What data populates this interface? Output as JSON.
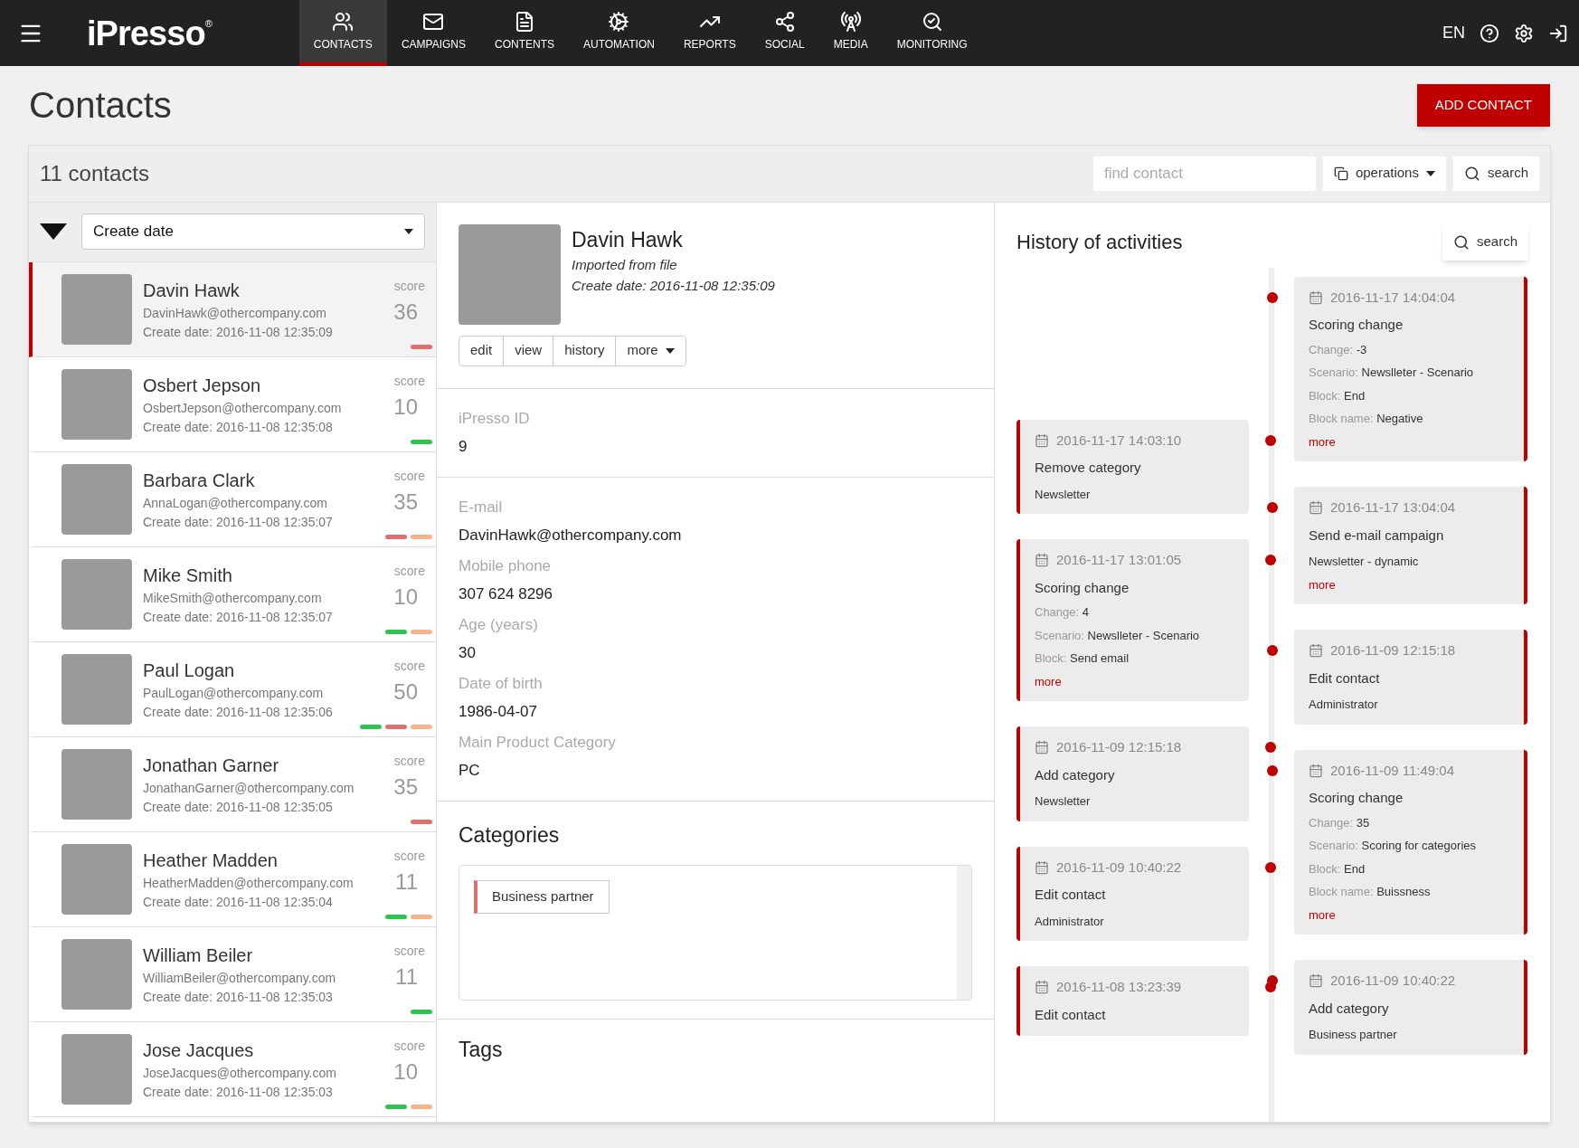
{
  "nav": {
    "logo": "iPresso",
    "logo_mark": "®",
    "items": [
      {
        "label": "CONTACTS",
        "selected": true
      },
      {
        "label": "CAMPAIGNS",
        "selected": false
      },
      {
        "label": "CONTENTS",
        "selected": false
      },
      {
        "label": "AUTOMATION",
        "selected": false
      },
      {
        "label": "REPORTS",
        "selected": false
      },
      {
        "label": "SOCIAL",
        "selected": false
      },
      {
        "label": "MEDIA",
        "selected": false
      },
      {
        "label": "MONITORING",
        "selected": false
      }
    ],
    "language": "EN"
  },
  "page": {
    "title": "Contacts",
    "add_button": "ADD CONTACT"
  },
  "panel": {
    "count": "11 contacts",
    "find_placeholder": "find contact",
    "operations": "operations",
    "search": "search"
  },
  "sort": {
    "value": "Create date"
  },
  "contacts": [
    {
      "name": "Davin Hawk",
      "email": "DavinHawk@othercompany.com",
      "created": "Create date: 2016-11-08 12:35:09",
      "score_label": "score",
      "score": "36",
      "selected": true,
      "bars": [
        {
          "color": "#e07070"
        }
      ]
    },
    {
      "name": "Osbert Jepson",
      "email": "OsbertJepson@othercompany.com",
      "created": "Create date: 2016-11-08 12:35:08",
      "score_label": "score",
      "score": "10",
      "selected": false,
      "bars": [
        {
          "color": "#2ec44f"
        }
      ]
    },
    {
      "name": "Barbara Clark",
      "email": "AnnaLogan@othercompany.com",
      "created": "Create date: 2016-11-08 12:35:07",
      "score_label": "score",
      "score": "35",
      "selected": false,
      "bars": [
        {
          "color": "#e07070"
        },
        {
          "color": "#f7b48a"
        }
      ]
    },
    {
      "name": "Mike Smith",
      "email": "MikeSmith@othercompany.com",
      "created": "Create date: 2016-11-08 12:35:07",
      "score_label": "score",
      "score": "10",
      "selected": false,
      "bars": [
        {
          "color": "#2ec44f"
        },
        {
          "color": "#f7b48a"
        }
      ]
    },
    {
      "name": "Paul Logan",
      "email": "PaulLogan@othercompany.com",
      "created": "Create date: 2016-11-08 12:35:06",
      "score_label": "score",
      "score": "50",
      "selected": false,
      "bars": [
        {
          "color": "#2ec44f"
        },
        {
          "color": "#e07070"
        },
        {
          "color": "#f7b48a"
        }
      ]
    },
    {
      "name": "Jonathan Garner",
      "email": "JonathanGarner@othercompany.com",
      "created": "Create date: 2016-11-08 12:35:05",
      "score_label": "score",
      "score": "35",
      "selected": false,
      "bars": [
        {
          "color": "#e07070"
        }
      ]
    },
    {
      "name": "Heather Madden",
      "email": "HeatherMadden@othercompany.com",
      "created": "Create date: 2016-11-08 12:35:04",
      "score_label": "score",
      "score": "11",
      "selected": false,
      "bars": [
        {
          "color": "#2ec44f"
        },
        {
          "color": "#f7b48a"
        }
      ]
    },
    {
      "name": "William Beiler",
      "email": "WilliamBeiler@othercompany.com",
      "created": "Create date: 2016-11-08 12:35:03",
      "score_label": "score",
      "score": "11",
      "selected": false,
      "bars": [
        {
          "color": "#2ec44f"
        }
      ]
    },
    {
      "name": "Jose Jacques",
      "email": "JoseJacques@othercompany.com",
      "created": "Create date: 2016-11-08 12:35:03",
      "score_label": "score",
      "score": "10",
      "selected": false,
      "bars": [
        {
          "color": "#2ec44f"
        },
        {
          "color": "#f7b48a"
        }
      ]
    }
  ],
  "detail": {
    "name": "Davin Hawk",
    "source": "Imported from file",
    "created": "Create date: 2016-11-08 12:35:09",
    "actions": [
      {
        "label": "edit",
        "kind": "plain"
      },
      {
        "label": "view",
        "kind": "plain"
      },
      {
        "label": "history",
        "kind": "plain"
      },
      {
        "label": "more",
        "kind": "dropdown"
      }
    ],
    "sections": [
      [
        {
          "label": "iPresso ID",
          "value": "9"
        }
      ],
      [
        {
          "label": "E-mail",
          "value": "DavinHawk@othercompany.com"
        },
        {
          "label": "Mobile phone",
          "value": "307 624 8296"
        },
        {
          "label": "Age (years)",
          "value": "30"
        },
        {
          "label": "Date of birth",
          "value": "1986-04-07"
        },
        {
          "label": "Main Product Category",
          "value": "PC"
        }
      ]
    ],
    "categories_title": "Categories",
    "categories": [
      "Business partner"
    ],
    "tags_title": "Tags"
  },
  "history": {
    "title": "History of activities",
    "search": "search",
    "left_column": [
      {
        "date": "2016-11-17 14:03:10",
        "title": "Remove category",
        "note": "Newsletter"
      },
      {
        "date": "2016-11-17 13:01:05",
        "title": "Scoring change",
        "details": [
          {
            "label": "Change:",
            "value": "4"
          },
          {
            "label": "Scenario:",
            "value": "Newslleter - Scenario"
          },
          {
            "label": "Block:",
            "value": "Send email"
          }
        ],
        "more": "more"
      },
      {
        "date": "2016-11-09 12:15:18",
        "title": "Add category",
        "note": "Newsletter"
      },
      {
        "date": "2016-11-09 10:40:22",
        "title": "Edit contact",
        "note": "Administrator"
      },
      {
        "date": "2016-11-08 13:23:39",
        "title": "Edit contact"
      }
    ],
    "right_column": [
      {
        "date": "2016-11-17 14:04:04",
        "title": "Scoring change",
        "details": [
          {
            "label": "Change:",
            "value": "-3"
          },
          {
            "label": "Scenario:",
            "value": "Newslleter - Scenario"
          },
          {
            "label": "Block:",
            "value": "End"
          },
          {
            "label": "Block name:",
            "value": "Negative"
          }
        ],
        "more": "more"
      },
      {
        "date": "2016-11-17 13:04:04",
        "title": "Send e-mail campaign",
        "note": "Newsletter - dynamic",
        "more": "more"
      },
      {
        "date": "2016-11-09 12:15:18",
        "title": "Edit contact",
        "note": "Administrator"
      },
      {
        "date": "2016-11-09 11:49:04",
        "title": "Scoring change",
        "details": [
          {
            "label": "Change:",
            "value": "35"
          },
          {
            "label": "Scenario:",
            "value": "Scoring for categories"
          },
          {
            "label": "Block:",
            "value": "End"
          },
          {
            "label": "Block name:",
            "value": "Buissness"
          }
        ],
        "more": "more"
      },
      {
        "date": "2016-11-09 10:40:22",
        "title": "Add category",
        "note": "Business partner"
      }
    ]
  }
}
